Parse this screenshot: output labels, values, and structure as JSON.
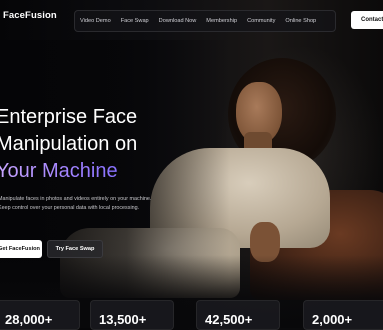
{
  "nav": {
    "brand": "FaceFusion",
    "items": [
      {
        "label": "Video Demo"
      },
      {
        "label": "Face Swap"
      },
      {
        "label": "Download Now"
      },
      {
        "label": "Membership"
      },
      {
        "label": "Community"
      },
      {
        "label": "Online Shop"
      }
    ],
    "contact_label": "Contact"
  },
  "hero": {
    "title_lines": [
      "Enterprise Face",
      "Manipulation on",
      "Your Machine"
    ],
    "description_lines": [
      "Manipulate faces in photos and videos entirely on your machine.",
      "Keep control over your personal data with local processing."
    ],
    "primary_cta": "Get FaceFusion",
    "secondary_cta": "Try Face Swap"
  },
  "stats": [
    {
      "value": "28,000+"
    },
    {
      "value": "13,500+"
    },
    {
      "value": "42,500+"
    },
    {
      "value": "2,000+"
    }
  ],
  "colors": {
    "accent_gradient_start": "#c9a6ff",
    "accent_gradient_end": "#7d6bff",
    "background": "#0a0a0c"
  }
}
